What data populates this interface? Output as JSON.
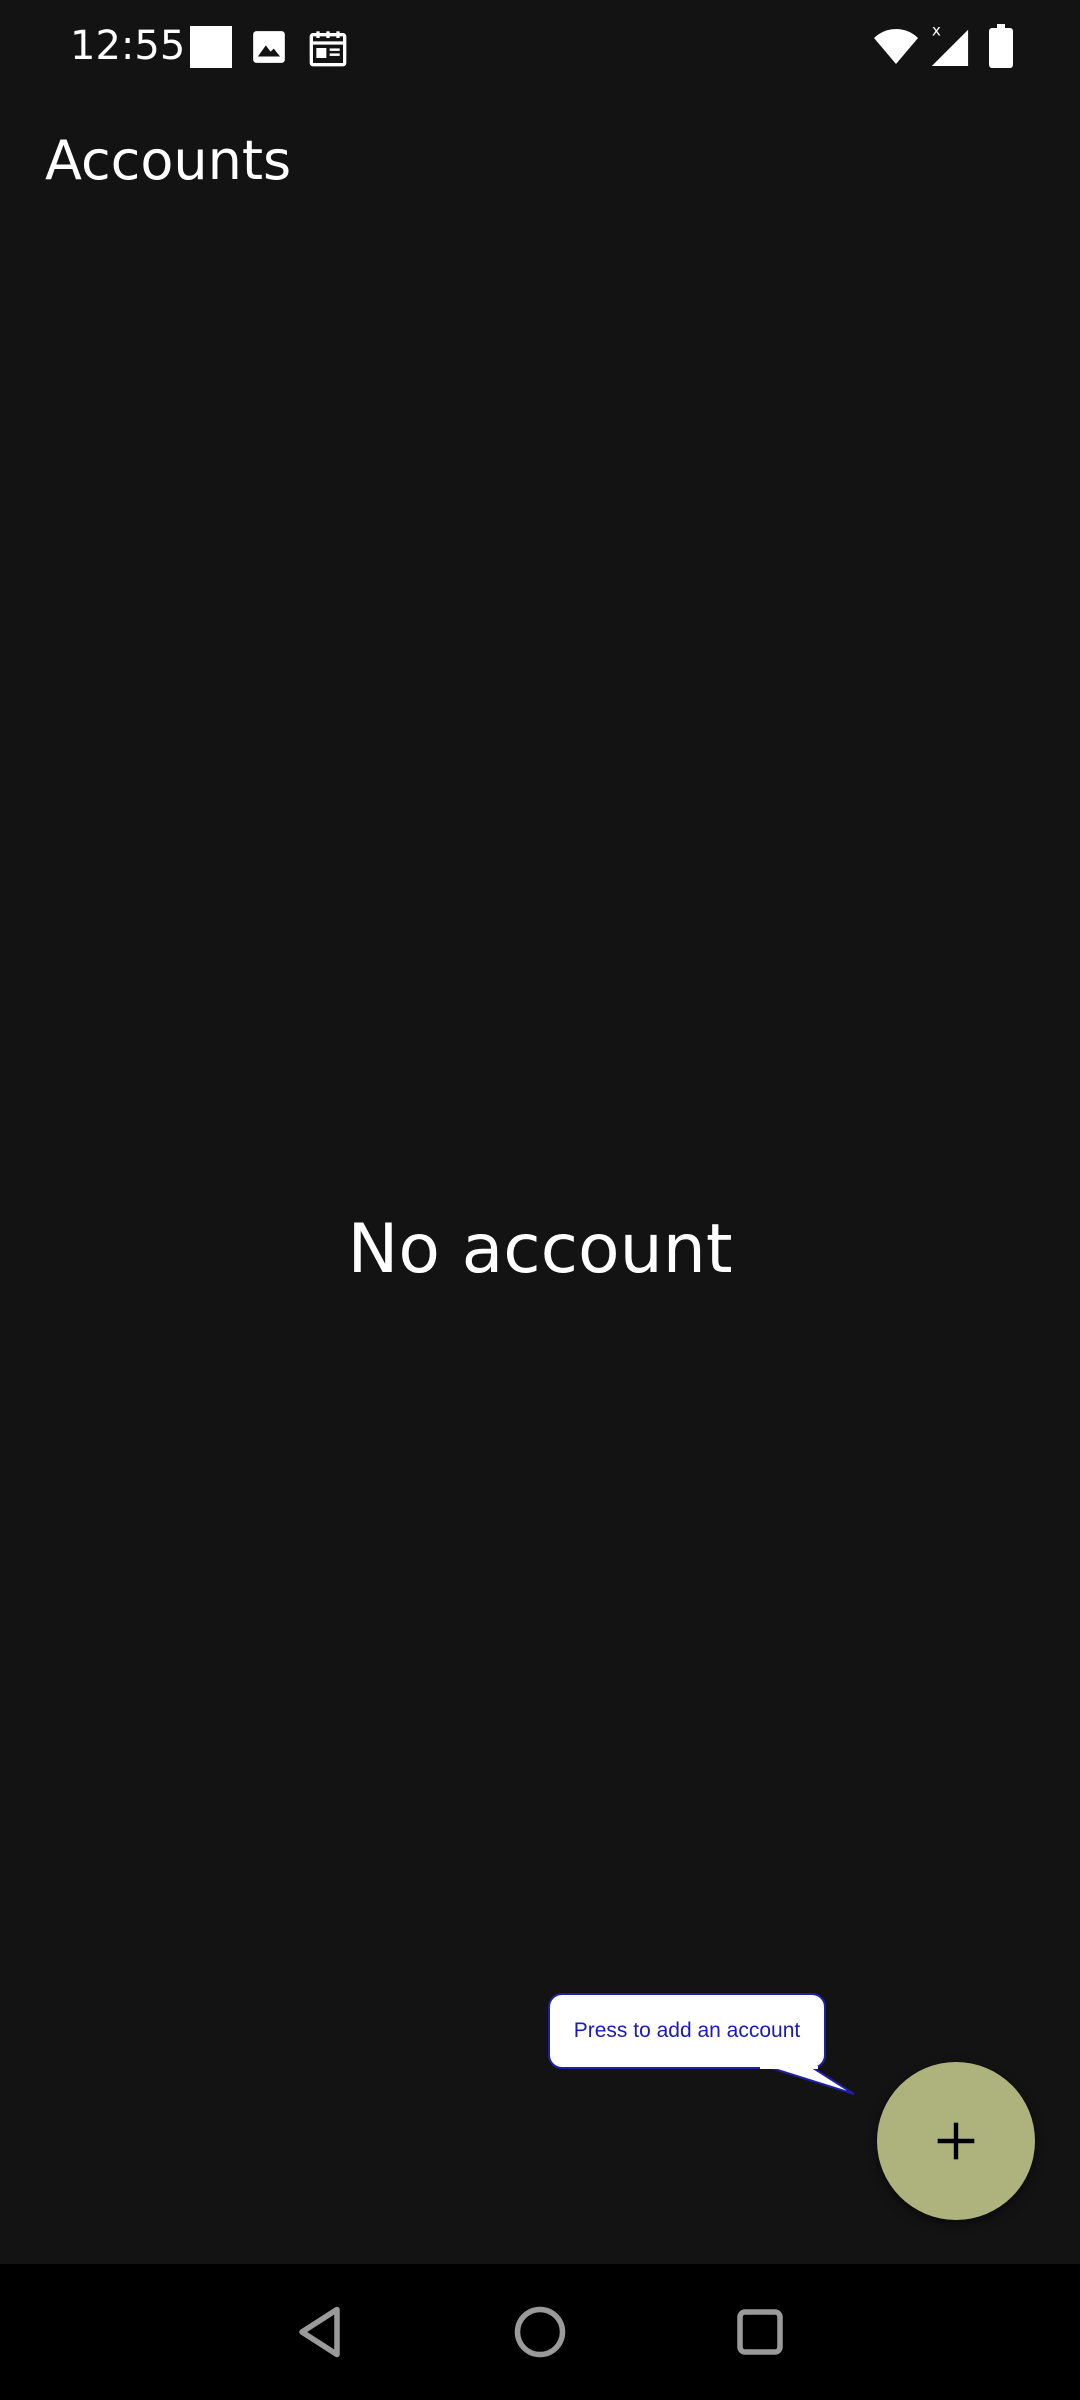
{
  "status_bar": {
    "time": "12:55",
    "notification_icons": [
      "square-notification-icon",
      "image-icon",
      "calendar-icon"
    ],
    "system_icons": [
      "wifi-icon",
      "signal-icon",
      "battery-icon"
    ],
    "signal_badge": "x"
  },
  "app_bar": {
    "title": "Accounts"
  },
  "main": {
    "empty_message": "No account"
  },
  "tooltip": {
    "text": "Press to add an account",
    "border_color": "#1f1fa6",
    "text_color": "#1a1ab8"
  },
  "fab": {
    "icon": "plus-icon",
    "color": "#aeb37e"
  },
  "nav_bar": {
    "buttons": [
      "back-icon",
      "home-icon",
      "recents-icon"
    ]
  },
  "colors": {
    "background": "#131313",
    "nav_background": "#000000",
    "text": "#ffffff"
  }
}
